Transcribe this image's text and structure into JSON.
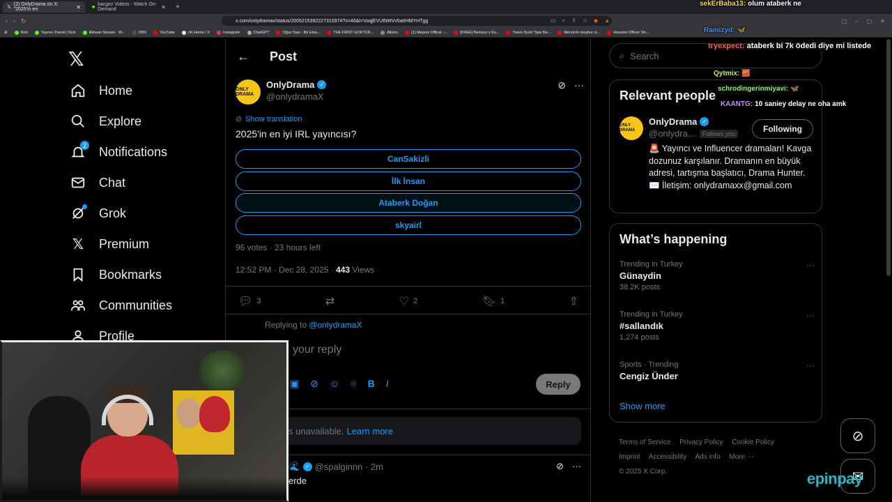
{
  "browser": {
    "tabs": [
      {
        "title": "(2) OnlyDrama on X: \"2025'in en",
        "active": true
      },
      {
        "title": "kacgez Videos - Watch On-Demand",
        "active": false
      }
    ],
    "url": "x.com/onlydramax/status/2005215392227315974?s=46&t=VoqjEVU6WtVv5aIIHMYHTgg",
    "bookmarks": [
      "Kick",
      "Yayıncı Paneli | Kick",
      "ilkinsan Stream - W...",
      "OBS",
      "YouTube",
      "(4) Home / X",
      "Instagram",
      "ChatGPT",
      "Oğuz Sasi - Bir Elsa...",
      "THE FIRST GOKTUR...",
      "Albüm",
      "(1) Meprez Offical -...",
      "[FREE] Nemzzz x Ks...",
      "Travis Scott Type Be...",
      "Mersin'in meşhur ci...",
      "Houston Officer Sh..."
    ]
  },
  "nav": {
    "items": [
      {
        "label": "Home",
        "icon": "home-icon"
      },
      {
        "label": "Explore",
        "icon": "search-icon"
      },
      {
        "label": "Notifications",
        "icon": "bell-icon",
        "badge": "2"
      },
      {
        "label": "Chat",
        "icon": "mail-icon"
      },
      {
        "label": "Grok",
        "icon": "grok-icon"
      },
      {
        "label": "Premium",
        "icon": "x-icon"
      },
      {
        "label": "Bookmarks",
        "icon": "bookmark-icon"
      },
      {
        "label": "Communities",
        "icon": "people-icon"
      },
      {
        "label": "Profile",
        "icon": "person-icon"
      }
    ]
  },
  "post": {
    "header_title": "Post",
    "author_name": "OnlyDrama",
    "author_handle": "@onlydramaX",
    "avatar_text": "ONLY DRAMA",
    "translate_label": "Show translation",
    "text": "2025'in en iyi IRL yayıncısı?",
    "poll_options": [
      "CanSakizli",
      "İlk İnsan",
      "Ataberk Doğan",
      "skyairl"
    ],
    "poll_meta": "96 votes · 23 hours left",
    "time": "12:52 PM · Dec 28, 2025 · ",
    "views_count": "443",
    "views_label": " Views",
    "replies": "3",
    "likes": "2",
    "bookmarks": "1",
    "replying_label": "Replying to ",
    "replying_handle": "@onlydramaX",
    "reply_placeholder": "your reply",
    "reply_button": "Reply",
    "unavailable_text": "s unavailable.",
    "learn_more": "Learn more",
    "reply2_handle": "@spalginnn · 2m",
    "reply2_text": "erde"
  },
  "right": {
    "search_placeholder": "Search",
    "relevant_title": "Relevant people",
    "rp_name": "OnlyDrama",
    "rp_handle": "@onlydra...",
    "rp_follows_you": "Follows you",
    "rp_follow_btn": "Following",
    "rp_bio": "🚨 Yayıncı ve Influencer dramaları! Kavga dozunuz karşılanır. Dramanın en büyük adresi, tartışma başlatıcı, Drama Hunter. ✉️ İletişim: onlydramaxx@gmail.com",
    "happening_title": "What’s happening",
    "trends": [
      {
        "meta": "Trending in Turkey",
        "name": "Günaydin",
        "count": "38.2K posts"
      },
      {
        "meta": "Trending in Turkey",
        "name": "#sallandık",
        "count": "1,274 posts"
      },
      {
        "meta": "Sports · Trending",
        "name": "Cengiz Ünder",
        "count": ""
      }
    ],
    "show_more": "Show more",
    "footer": [
      "Terms of Service",
      "Privacy Policy",
      "Cookie Policy",
      "Imprint",
      "Accessibility",
      "Ads info",
      "More ···",
      "© 2025 X Corp."
    ]
  },
  "chat": [
    {
      "user": "sekErBaba13:",
      "msg": "olum ataberk ne",
      "color": "#ffd23f"
    },
    {
      "user": "Ramizyd:",
      "msg": "🦋",
      "color": "#4f8cff"
    },
    {
      "user": "tryexpect:",
      "msg": "ataberk bi 7k ödedi diye mi listede",
      "color": "#ff5b5b"
    },
    {
      "user": "Qytmix:",
      "msg": "🧱",
      "color": "#b6f26b"
    },
    {
      "user": "schrodingerinmiyavi:",
      "msg": "🦋",
      "color": "#8ef26b"
    },
    {
      "user": "KAANTG:",
      "msg": "10 saniey delay ne oha amk",
      "color": "#c58bff"
    }
  ],
  "brand": "epinpay",
  "colors": {
    "accent": "#1d9bf0",
    "bg": "#000000",
    "border": "#2f3336",
    "muted": "#71767b"
  }
}
